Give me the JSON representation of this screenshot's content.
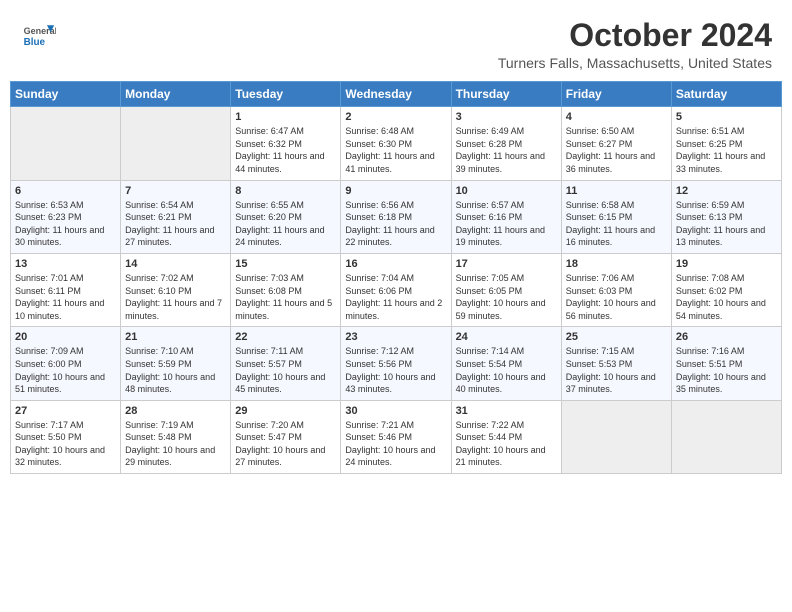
{
  "header": {
    "logo": {
      "general": "General",
      "blue": "Blue"
    },
    "title": "October 2024",
    "location": "Turners Falls, Massachusetts, United States"
  },
  "days_of_week": [
    "Sunday",
    "Monday",
    "Tuesday",
    "Wednesday",
    "Thursday",
    "Friday",
    "Saturday"
  ],
  "weeks": [
    [
      {
        "day": "",
        "info": ""
      },
      {
        "day": "",
        "info": ""
      },
      {
        "day": "1",
        "info": "Sunrise: 6:47 AM\nSunset: 6:32 PM\nDaylight: 11 hours and 44 minutes."
      },
      {
        "day": "2",
        "info": "Sunrise: 6:48 AM\nSunset: 6:30 PM\nDaylight: 11 hours and 41 minutes."
      },
      {
        "day": "3",
        "info": "Sunrise: 6:49 AM\nSunset: 6:28 PM\nDaylight: 11 hours and 39 minutes."
      },
      {
        "day": "4",
        "info": "Sunrise: 6:50 AM\nSunset: 6:27 PM\nDaylight: 11 hours and 36 minutes."
      },
      {
        "day": "5",
        "info": "Sunrise: 6:51 AM\nSunset: 6:25 PM\nDaylight: 11 hours and 33 minutes."
      }
    ],
    [
      {
        "day": "6",
        "info": "Sunrise: 6:53 AM\nSunset: 6:23 PM\nDaylight: 11 hours and 30 minutes."
      },
      {
        "day": "7",
        "info": "Sunrise: 6:54 AM\nSunset: 6:21 PM\nDaylight: 11 hours and 27 minutes."
      },
      {
        "day": "8",
        "info": "Sunrise: 6:55 AM\nSunset: 6:20 PM\nDaylight: 11 hours and 24 minutes."
      },
      {
        "day": "9",
        "info": "Sunrise: 6:56 AM\nSunset: 6:18 PM\nDaylight: 11 hours and 22 minutes."
      },
      {
        "day": "10",
        "info": "Sunrise: 6:57 AM\nSunset: 6:16 PM\nDaylight: 11 hours and 19 minutes."
      },
      {
        "day": "11",
        "info": "Sunrise: 6:58 AM\nSunset: 6:15 PM\nDaylight: 11 hours and 16 minutes."
      },
      {
        "day": "12",
        "info": "Sunrise: 6:59 AM\nSunset: 6:13 PM\nDaylight: 11 hours and 13 minutes."
      }
    ],
    [
      {
        "day": "13",
        "info": "Sunrise: 7:01 AM\nSunset: 6:11 PM\nDaylight: 11 hours and 10 minutes."
      },
      {
        "day": "14",
        "info": "Sunrise: 7:02 AM\nSunset: 6:10 PM\nDaylight: 11 hours and 7 minutes."
      },
      {
        "day": "15",
        "info": "Sunrise: 7:03 AM\nSunset: 6:08 PM\nDaylight: 11 hours and 5 minutes."
      },
      {
        "day": "16",
        "info": "Sunrise: 7:04 AM\nSunset: 6:06 PM\nDaylight: 11 hours and 2 minutes."
      },
      {
        "day": "17",
        "info": "Sunrise: 7:05 AM\nSunset: 6:05 PM\nDaylight: 10 hours and 59 minutes."
      },
      {
        "day": "18",
        "info": "Sunrise: 7:06 AM\nSunset: 6:03 PM\nDaylight: 10 hours and 56 minutes."
      },
      {
        "day": "19",
        "info": "Sunrise: 7:08 AM\nSunset: 6:02 PM\nDaylight: 10 hours and 54 minutes."
      }
    ],
    [
      {
        "day": "20",
        "info": "Sunrise: 7:09 AM\nSunset: 6:00 PM\nDaylight: 10 hours and 51 minutes."
      },
      {
        "day": "21",
        "info": "Sunrise: 7:10 AM\nSunset: 5:59 PM\nDaylight: 10 hours and 48 minutes."
      },
      {
        "day": "22",
        "info": "Sunrise: 7:11 AM\nSunset: 5:57 PM\nDaylight: 10 hours and 45 minutes."
      },
      {
        "day": "23",
        "info": "Sunrise: 7:12 AM\nSunset: 5:56 PM\nDaylight: 10 hours and 43 minutes."
      },
      {
        "day": "24",
        "info": "Sunrise: 7:14 AM\nSunset: 5:54 PM\nDaylight: 10 hours and 40 minutes."
      },
      {
        "day": "25",
        "info": "Sunrise: 7:15 AM\nSunset: 5:53 PM\nDaylight: 10 hours and 37 minutes."
      },
      {
        "day": "26",
        "info": "Sunrise: 7:16 AM\nSunset: 5:51 PM\nDaylight: 10 hours and 35 minutes."
      }
    ],
    [
      {
        "day": "27",
        "info": "Sunrise: 7:17 AM\nSunset: 5:50 PM\nDaylight: 10 hours and 32 minutes."
      },
      {
        "day": "28",
        "info": "Sunrise: 7:19 AM\nSunset: 5:48 PM\nDaylight: 10 hours and 29 minutes."
      },
      {
        "day": "29",
        "info": "Sunrise: 7:20 AM\nSunset: 5:47 PM\nDaylight: 10 hours and 27 minutes."
      },
      {
        "day": "30",
        "info": "Sunrise: 7:21 AM\nSunset: 5:46 PM\nDaylight: 10 hours and 24 minutes."
      },
      {
        "day": "31",
        "info": "Sunrise: 7:22 AM\nSunset: 5:44 PM\nDaylight: 10 hours and 21 minutes."
      },
      {
        "day": "",
        "info": ""
      },
      {
        "day": "",
        "info": ""
      }
    ]
  ]
}
